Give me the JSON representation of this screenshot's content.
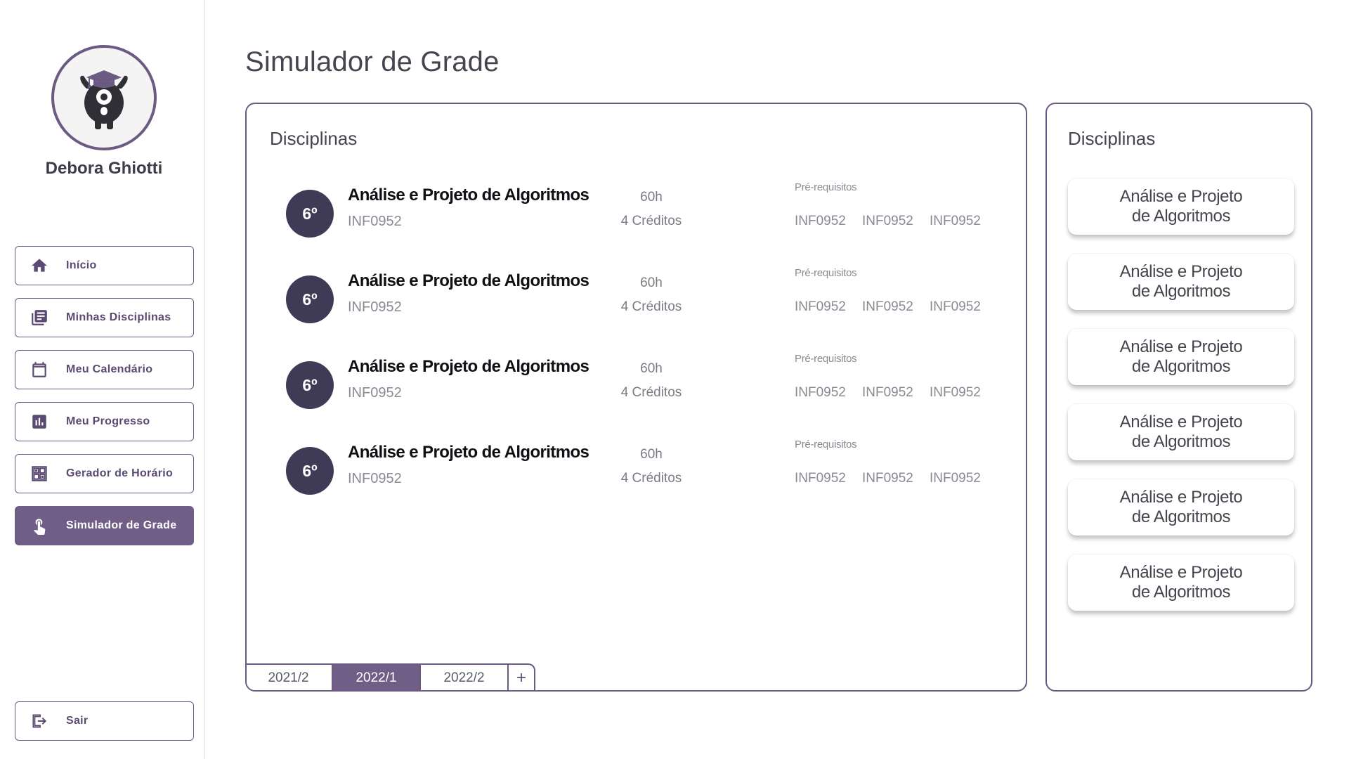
{
  "user": {
    "name": "Debora Ghiotti"
  },
  "nav": [
    {
      "label": "Início",
      "icon": "home-icon"
    },
    {
      "label": "Minhas Disciplinas",
      "icon": "library-books-icon"
    },
    {
      "label": "Meu Calendário",
      "icon": "calendar-icon"
    },
    {
      "label": "Meu Progresso",
      "icon": "bar-chart-icon"
    },
    {
      "label": "Gerador de Horário",
      "icon": "schedule-grid-icon"
    },
    {
      "label": "Simulador de Grade",
      "icon": "touch-hand-icon",
      "active": true
    }
  ],
  "logout": {
    "label": "Sair",
    "icon": "logout-icon"
  },
  "page": {
    "title": "Simulador de Grade"
  },
  "main_panel": {
    "title": "Disciplinas",
    "courses": [
      {
        "semester": "6º",
        "name": "Análise e Projeto de Algoritmos",
        "code": "INF0952",
        "hours": "60h",
        "credits": "4 Créditos",
        "prereq_label": "Pré-requisitos",
        "prereqs": [
          "INF0952",
          "INF0952",
          "INF0952"
        ]
      },
      {
        "semester": "6º",
        "name": "Análise e Projeto de Algoritmos",
        "code": "INF0952",
        "hours": "60h",
        "credits": "4 Créditos",
        "prereq_label": "Pré-requisitos",
        "prereqs": [
          "INF0952",
          "INF0952",
          "INF0952"
        ]
      },
      {
        "semester": "6º",
        "name": "Análise e Projeto de Algoritmos",
        "code": "INF0952",
        "hours": "60h",
        "credits": "4 Créditos",
        "prereq_label": "Pré-requisitos",
        "prereqs": [
          "INF0952",
          "INF0952",
          "INF0952"
        ]
      },
      {
        "semester": "6º",
        "name": "Análise e Projeto de Algoritmos",
        "code": "INF0952",
        "hours": "60h",
        "credits": "4 Créditos",
        "prereq_label": "Pré-requisitos",
        "prereqs": [
          "INF0952",
          "INF0952",
          "INF0952"
        ]
      }
    ],
    "tabs": [
      "2021/2",
      "2022/1",
      "2022/2"
    ],
    "active_tab": "2022/1",
    "add_tab_label": "+"
  },
  "side_panel": {
    "title": "Disciplinas",
    "cards": [
      "Análise e Projeto de Algoritmos",
      "Análise e Projeto de Algoritmos",
      "Análise e Projeto de Algoritmos",
      "Análise e Projeto de Algoritmos",
      "Análise e Projeto de Algoritmos",
      "Análise e Projeto de Algoritmos"
    ]
  },
  "colors": {
    "accent": "#715e87",
    "badge": "#3f3a55",
    "border": "#6b5a82"
  }
}
